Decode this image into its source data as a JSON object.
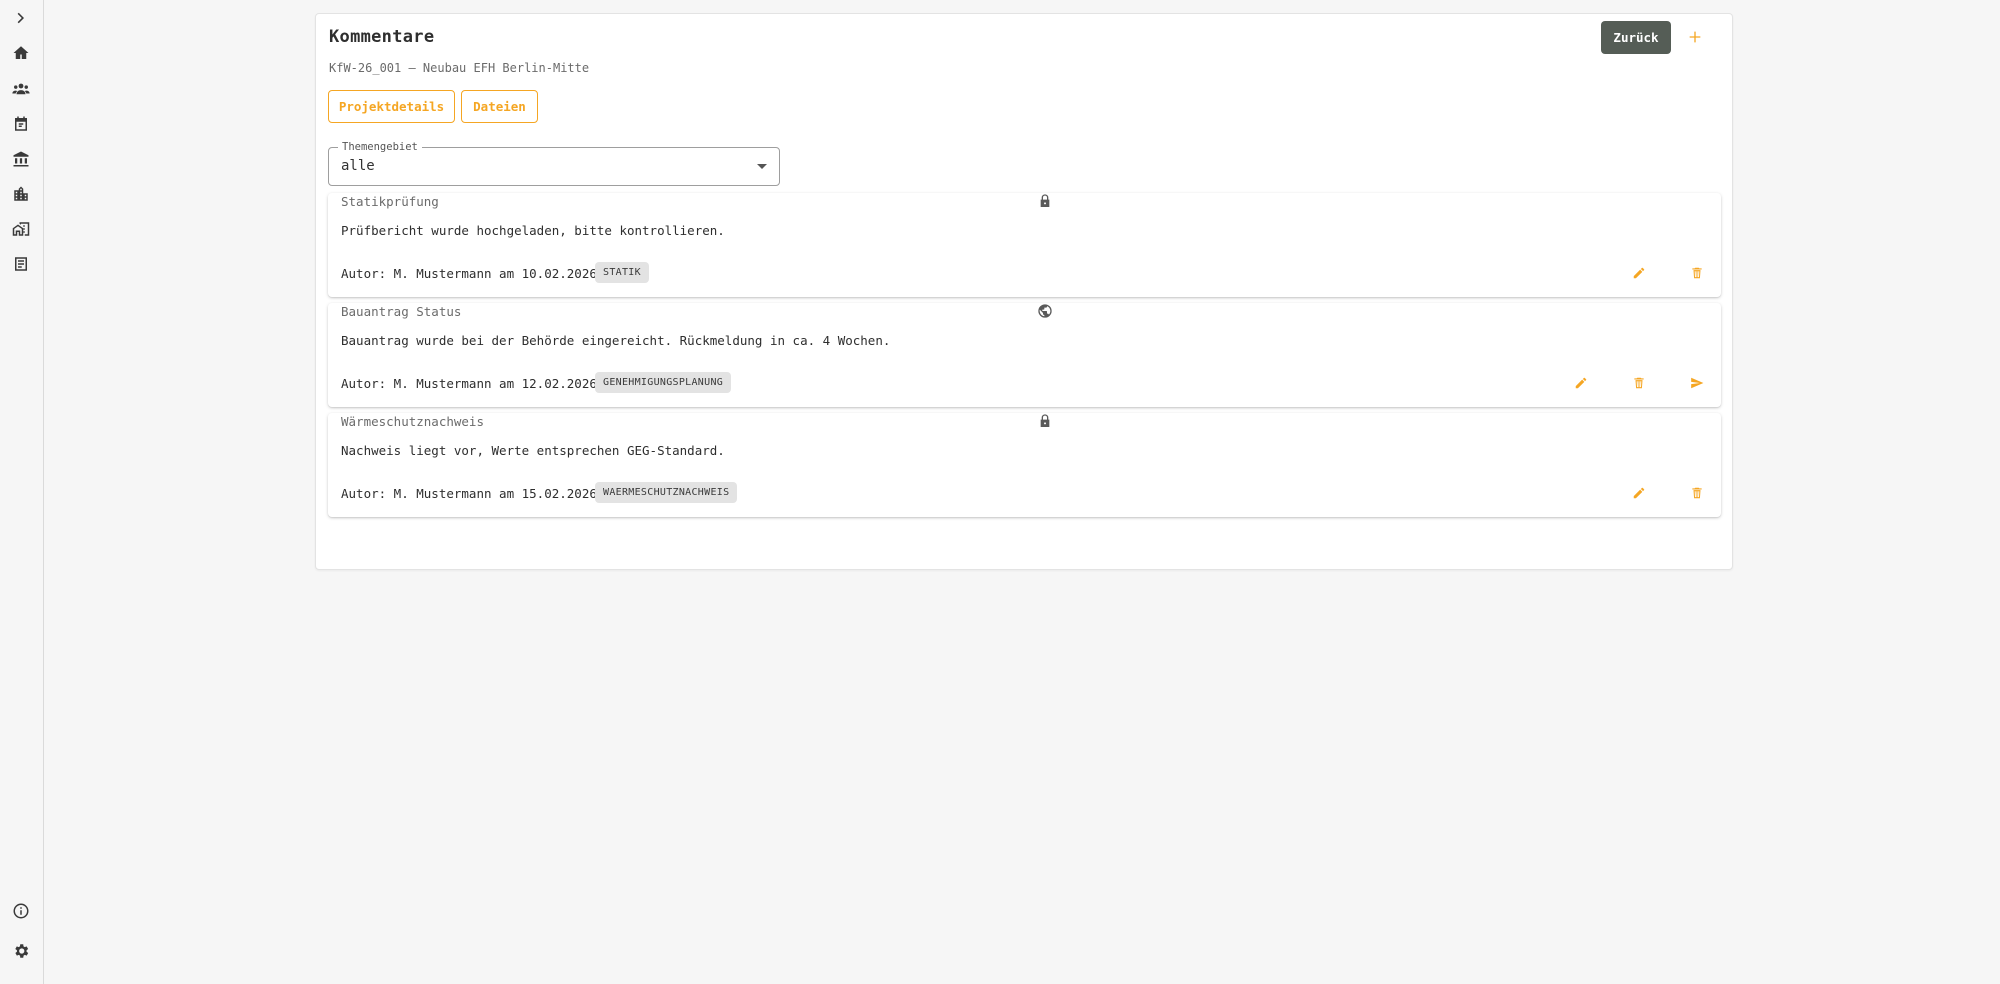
{
  "sidebar": {
    "items": [
      {
        "icon": "chevron-right-icon",
        "label": "expand"
      },
      {
        "icon": "home-icon",
        "label": "home"
      },
      {
        "icon": "people-icon",
        "label": "contacts"
      },
      {
        "icon": "calendar-icon",
        "label": "calendar"
      },
      {
        "icon": "bank-icon",
        "label": "institutions"
      },
      {
        "icon": "building-icon",
        "label": "buildings"
      },
      {
        "icon": "city-icon",
        "label": "projects"
      },
      {
        "icon": "comments-icon",
        "label": "comments"
      },
      {
        "icon": "info-icon",
        "label": "info"
      },
      {
        "icon": "gear-icon",
        "label": "settings"
      }
    ]
  },
  "header": {
    "title": "Kommentare",
    "subtitle": "KfW-26_001 – Neubau EFH Berlin-Mitte",
    "back_label": "Zurück",
    "add_icon": "plus-icon"
  },
  "tabs": {
    "projektdetails": "Projektdetails",
    "dateien": "Dateien"
  },
  "filter": {
    "label": "Themengebiet",
    "value": "alle"
  },
  "comments": [
    {
      "title": "Statikprüfung",
      "visibility": "lock-icon",
      "body": "Prüfbericht wurde hochgeladen, bitte kontrollieren.",
      "author": "Autor: M. Mustermann am 10.02.2026",
      "tag": "STATIK",
      "actions": [
        "edit-icon",
        "delete-icon"
      ]
    },
    {
      "title": "Bauantrag Status",
      "visibility": "globe-icon",
      "body": "Bauantrag wurde bei der Behörde eingereicht. Rückmeldung in ca. 4 Wochen.",
      "author": "Autor: M. Mustermann am 12.02.2026",
      "tag": "GENEHMIGUNGSPLANUNG",
      "actions": [
        "edit-icon",
        "delete-icon",
        "send-icon"
      ]
    },
    {
      "title": "Wärmeschutznachweis",
      "visibility": "lock-icon",
      "body": "Nachweis liegt vor, Werte entsprechen GEG-Standard.",
      "author": "Autor: M. Mustermann am 15.02.2026",
      "tag": "WAERMESCHUTZNACHWEIS",
      "actions": [
        "edit-icon",
        "delete-icon"
      ]
    }
  ],
  "colors": {
    "accent": "#f5a623",
    "back_button": "#555d56",
    "chip": "#e3e3e3"
  }
}
